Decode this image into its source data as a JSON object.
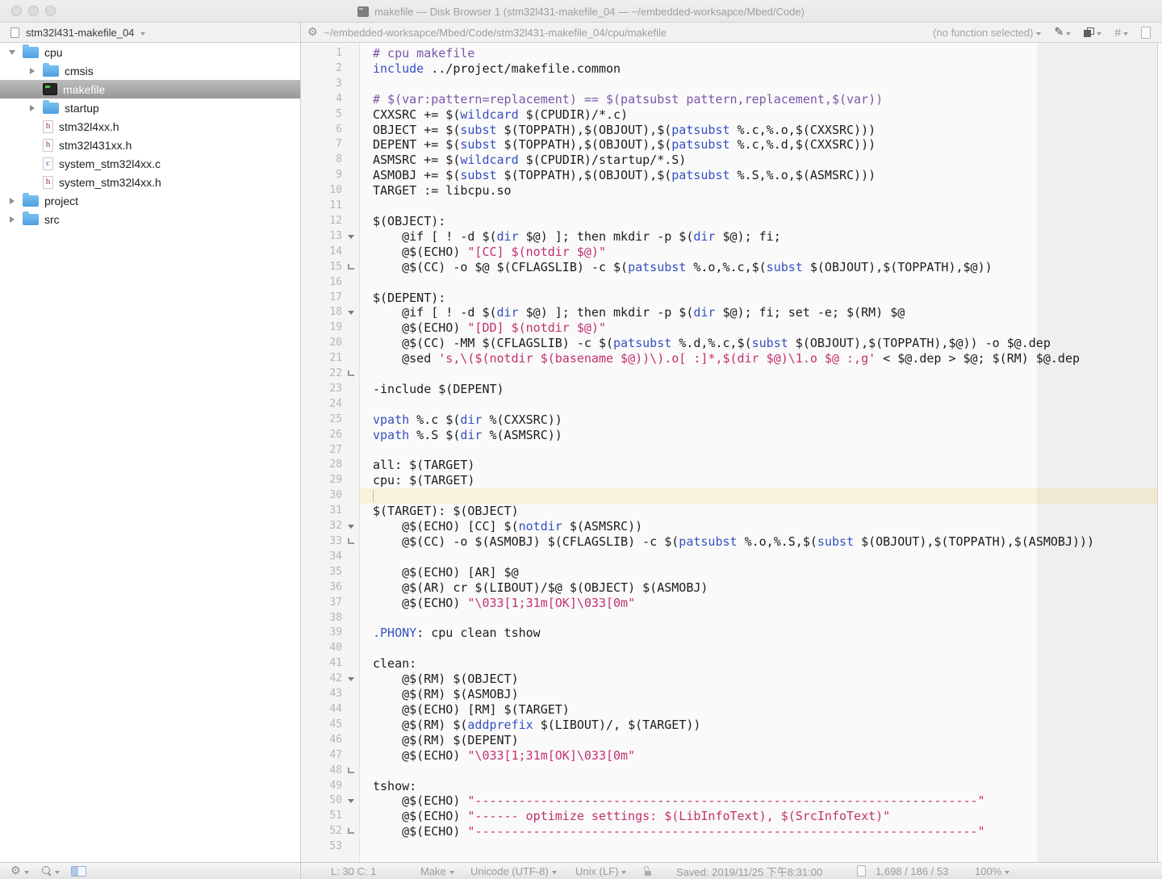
{
  "window": {
    "title": "makefile — Disk Browser 1 (stm32l431-makefile_04 — ~/embedded-worksapce/Mbed/Code)"
  },
  "project_bar": {
    "name": "stm32l431-makefile_04"
  },
  "path_bar": {
    "path": "~/embedded-worksapce/Mbed/Code/stm32l431-makefile_04/cpu/makefile",
    "function_selector": "(no function selected)"
  },
  "icons": {
    "gear": "⚙",
    "pencil": "✎",
    "traffic_lights": "inactive-gray",
    "search": "magnifier-shape",
    "panel_toggle": "split-rect",
    "lock": "unlocked-padlock"
  },
  "colors": {
    "keyword": "#3550c2",
    "comment": "#7a56a8",
    "string": "#c3306f",
    "plain": "#1c1c1c",
    "current_line": "#f8f4da",
    "selection_gray_top": "#bcbcbc",
    "folder_blue": "#4d9fe0"
  },
  "sidebar": {
    "items": [
      {
        "label": "cpu",
        "depth": 0,
        "icon": "folder",
        "disclosure": "open",
        "selected": false
      },
      {
        "label": "cmsis",
        "depth": 1,
        "icon": "folder",
        "disclosure": "closed",
        "selected": false
      },
      {
        "label": "makefile",
        "depth": 1,
        "icon": "makefile",
        "disclosure": "none",
        "selected": true
      },
      {
        "label": "startup",
        "depth": 1,
        "icon": "folder",
        "disclosure": "closed",
        "selected": false
      },
      {
        "label": "stm32l4xx.h",
        "depth": 1,
        "icon": "h",
        "disclosure": "none",
        "selected": false
      },
      {
        "label": "stm32l431xx.h",
        "depth": 1,
        "icon": "h",
        "disclosure": "none",
        "selected": false
      },
      {
        "label": "system_stm32l4xx.c",
        "depth": 1,
        "icon": "c",
        "disclosure": "none",
        "selected": false
      },
      {
        "label": "system_stm32l4xx.h",
        "depth": 1,
        "icon": "h",
        "disclosure": "none",
        "selected": false
      },
      {
        "label": "project",
        "depth": 0,
        "icon": "folder",
        "disclosure": "closed",
        "selected": false
      },
      {
        "label": "src",
        "depth": 0,
        "icon": "folder",
        "disclosure": "closed",
        "selected": false
      }
    ]
  },
  "editor": {
    "caret_line": 30,
    "lines": [
      {
        "n": 1,
        "fold": "",
        "cur": false,
        "spans": [
          [
            "c",
            "# cpu makefile"
          ]
        ]
      },
      {
        "n": 2,
        "fold": "",
        "cur": false,
        "spans": [
          [
            "k",
            "include"
          ],
          [
            "t",
            " ../project/makefile.common"
          ]
        ]
      },
      {
        "n": 3,
        "fold": "",
        "cur": false,
        "spans": []
      },
      {
        "n": 4,
        "fold": "",
        "cur": false,
        "spans": [
          [
            "c",
            "# $(var:pattern=replacement) == $(patsubst pattern,replacement,$(var))"
          ]
        ]
      },
      {
        "n": 5,
        "fold": "",
        "cur": false,
        "spans": [
          [
            "t",
            "CXXSRC += $("
          ],
          [
            "k",
            "wildcard"
          ],
          [
            "t",
            " $(CPUDIR)/*.c)"
          ]
        ]
      },
      {
        "n": 6,
        "fold": "",
        "cur": false,
        "spans": [
          [
            "t",
            "OBJECT += $("
          ],
          [
            "k",
            "subst"
          ],
          [
            "t",
            " $(TOPPATH),$(OBJOUT),$("
          ],
          [
            "k",
            "patsubst"
          ],
          [
            "t",
            " %.c,%.o,$(CXXSRC)))"
          ]
        ]
      },
      {
        "n": 7,
        "fold": "",
        "cur": false,
        "spans": [
          [
            "t",
            "DEPENT += $("
          ],
          [
            "k",
            "subst"
          ],
          [
            "t",
            " $(TOPPATH),$(OBJOUT),$("
          ],
          [
            "k",
            "patsubst"
          ],
          [
            "t",
            " %.c,%.d,$(CXXSRC)))"
          ]
        ]
      },
      {
        "n": 8,
        "fold": "",
        "cur": false,
        "spans": [
          [
            "t",
            "ASMSRC += $("
          ],
          [
            "k",
            "wildcard"
          ],
          [
            "t",
            " $(CPUDIR)/startup/*.S)"
          ]
        ]
      },
      {
        "n": 9,
        "fold": "",
        "cur": false,
        "spans": [
          [
            "t",
            "ASMOBJ += $("
          ],
          [
            "k",
            "subst"
          ],
          [
            "t",
            " $(TOPPATH),$(OBJOUT),$("
          ],
          [
            "k",
            "patsubst"
          ],
          [
            "t",
            " %.S,%.o,$(ASMSRC)))"
          ]
        ]
      },
      {
        "n": 10,
        "fold": "",
        "cur": false,
        "spans": [
          [
            "t",
            "TARGET := libcpu.so"
          ]
        ]
      },
      {
        "n": 11,
        "fold": "",
        "cur": false,
        "spans": []
      },
      {
        "n": 12,
        "fold": "",
        "cur": false,
        "spans": [
          [
            "t",
            "$(OBJECT):"
          ]
        ]
      },
      {
        "n": 13,
        "fold": "start",
        "cur": false,
        "spans": [
          [
            "t",
            "    @if [ ! -d $("
          ],
          [
            "k",
            "dir"
          ],
          [
            "t",
            " $@) ]; then mkdir -p $("
          ],
          [
            "k",
            "dir"
          ],
          [
            "t",
            " $@); fi;"
          ]
        ]
      },
      {
        "n": 14,
        "fold": "",
        "cur": false,
        "spans": [
          [
            "t",
            "    @$(ECHO) "
          ],
          [
            "s",
            "\"[CC] $(notdir $@)\""
          ]
        ]
      },
      {
        "n": 15,
        "fold": "end",
        "cur": false,
        "spans": [
          [
            "t",
            "    @$(CC) -o $@ $(CFLAGSLIB) -c $("
          ],
          [
            "k",
            "patsubst"
          ],
          [
            "t",
            " %.o,%.c,$("
          ],
          [
            "k",
            "subst"
          ],
          [
            "t",
            " $(OBJOUT),$(TOPPATH),$@))"
          ]
        ]
      },
      {
        "n": 16,
        "fold": "",
        "cur": false,
        "spans": []
      },
      {
        "n": 17,
        "fold": "",
        "cur": false,
        "spans": [
          [
            "t",
            "$(DEPENT):"
          ]
        ]
      },
      {
        "n": 18,
        "fold": "start",
        "cur": false,
        "spans": [
          [
            "t",
            "    @if [ ! -d $("
          ],
          [
            "k",
            "dir"
          ],
          [
            "t",
            " $@) ]; then mkdir -p $("
          ],
          [
            "k",
            "dir"
          ],
          [
            "t",
            " $@); fi; set -e; $(RM) $@"
          ]
        ]
      },
      {
        "n": 19,
        "fold": "",
        "cur": false,
        "spans": [
          [
            "t",
            "    @$(ECHO) "
          ],
          [
            "s",
            "\"[DD] $(notdir $@)\""
          ]
        ]
      },
      {
        "n": 20,
        "fold": "",
        "cur": false,
        "spans": [
          [
            "t",
            "    @$(CC) -MM $(CFLAGSLIB) -c $("
          ],
          [
            "k",
            "patsubst"
          ],
          [
            "t",
            " %.d,%.c,$("
          ],
          [
            "k",
            "subst"
          ],
          [
            "t",
            " $(OBJOUT),$(TOPPATH),$@)) -o $@.dep"
          ]
        ]
      },
      {
        "n": 21,
        "fold": "",
        "cur": false,
        "spans": [
          [
            "t",
            "    @sed "
          ],
          [
            "s",
            "'s,\\($(notdir $(basename $@))\\).o[ :]*,$(dir $@)\\1.o $@ :,g'"
          ],
          [
            "t",
            " < $@.dep > $@; $(RM) $@.dep"
          ]
        ]
      },
      {
        "n": 22,
        "fold": "end",
        "cur": false,
        "spans": []
      },
      {
        "n": 23,
        "fold": "",
        "cur": false,
        "spans": [
          [
            "t",
            "-include $(DEPENT)"
          ]
        ]
      },
      {
        "n": 24,
        "fold": "",
        "cur": false,
        "spans": []
      },
      {
        "n": 25,
        "fold": "",
        "cur": false,
        "spans": [
          [
            "k",
            "vpath"
          ],
          [
            "t",
            " %.c $("
          ],
          [
            "k",
            "dir"
          ],
          [
            "t",
            " %(CXXSRC))"
          ]
        ]
      },
      {
        "n": 26,
        "fold": "",
        "cur": false,
        "spans": [
          [
            "k",
            "vpath"
          ],
          [
            "t",
            " %.S $("
          ],
          [
            "k",
            "dir"
          ],
          [
            "t",
            " %(ASMSRC))"
          ]
        ]
      },
      {
        "n": 27,
        "fold": "",
        "cur": false,
        "spans": []
      },
      {
        "n": 28,
        "fold": "",
        "cur": false,
        "spans": [
          [
            "t",
            "all: $(TARGET)"
          ]
        ]
      },
      {
        "n": 29,
        "fold": "",
        "cur": false,
        "spans": [
          [
            "t",
            "cpu: $(TARGET)"
          ]
        ]
      },
      {
        "n": 30,
        "fold": "",
        "cur": true,
        "spans": []
      },
      {
        "n": 31,
        "fold": "",
        "cur": false,
        "spans": [
          [
            "t",
            "$(TARGET): $(OBJECT)"
          ]
        ]
      },
      {
        "n": 32,
        "fold": "start",
        "cur": false,
        "spans": [
          [
            "t",
            "    @$(ECHO) [CC] $("
          ],
          [
            "k",
            "notdir"
          ],
          [
            "t",
            " $(ASMSRC))"
          ]
        ]
      },
      {
        "n": 33,
        "fold": "end",
        "cur": false,
        "spans": [
          [
            "t",
            "    @$(CC) -o $(ASMOBJ) $(CFLAGSLIB) -c $("
          ],
          [
            "k",
            "patsubst"
          ],
          [
            "t",
            " %.o,%.S,$("
          ],
          [
            "k",
            "subst"
          ],
          [
            "t",
            " $(OBJOUT),$(TOPPATH),$(ASMOBJ)))"
          ]
        ]
      },
      {
        "n": 34,
        "fold": "",
        "cur": false,
        "spans": []
      },
      {
        "n": 35,
        "fold": "",
        "cur": false,
        "spans": [
          [
            "t",
            "    @$(ECHO) [AR] $@"
          ]
        ]
      },
      {
        "n": 36,
        "fold": "",
        "cur": false,
        "spans": [
          [
            "t",
            "    @$(AR) cr $(LIBOUT)/$@ $(OBJECT) $(ASMOBJ)"
          ]
        ]
      },
      {
        "n": 37,
        "fold": "",
        "cur": false,
        "spans": [
          [
            "t",
            "    @$(ECHO) "
          ],
          [
            "s",
            "\"\\033[1;31m[OK]\\033[0m\""
          ]
        ]
      },
      {
        "n": 38,
        "fold": "",
        "cur": false,
        "spans": []
      },
      {
        "n": 39,
        "fold": "",
        "cur": false,
        "spans": [
          [
            "k",
            ".PHONY"
          ],
          [
            "t",
            ": cpu clean tshow"
          ]
        ]
      },
      {
        "n": 40,
        "fold": "",
        "cur": false,
        "spans": []
      },
      {
        "n": 41,
        "fold": "",
        "cur": false,
        "spans": [
          [
            "t",
            "clean:"
          ]
        ]
      },
      {
        "n": 42,
        "fold": "start",
        "cur": false,
        "spans": [
          [
            "t",
            "    @$(RM) $(OBJECT)"
          ]
        ]
      },
      {
        "n": 43,
        "fold": "",
        "cur": false,
        "spans": [
          [
            "t",
            "    @$(RM) $(ASMOBJ)"
          ]
        ]
      },
      {
        "n": 44,
        "fold": "",
        "cur": false,
        "spans": [
          [
            "t",
            "    @$(ECHO) [RM] $(TARGET)"
          ]
        ]
      },
      {
        "n": 45,
        "fold": "",
        "cur": false,
        "spans": [
          [
            "t",
            "    @$(RM) $("
          ],
          [
            "k",
            "addprefix"
          ],
          [
            "t",
            " $(LIBOUT)/, $(TARGET))"
          ]
        ]
      },
      {
        "n": 46,
        "fold": "",
        "cur": false,
        "spans": [
          [
            "t",
            "    @$(RM) $(DEPENT)"
          ]
        ]
      },
      {
        "n": 47,
        "fold": "",
        "cur": false,
        "spans": [
          [
            "t",
            "    @$(ECHO) "
          ],
          [
            "s",
            "\"\\033[1;31m[OK]\\033[0m\""
          ]
        ]
      },
      {
        "n": 48,
        "fold": "end",
        "cur": false,
        "spans": []
      },
      {
        "n": 49,
        "fold": "",
        "cur": false,
        "spans": [
          [
            "t",
            "tshow:"
          ]
        ]
      },
      {
        "n": 50,
        "fold": "start",
        "cur": false,
        "spans": [
          [
            "t",
            "    @$(ECHO) "
          ],
          [
            "s",
            "\"---------------------------------------------------------------------\""
          ]
        ]
      },
      {
        "n": 51,
        "fold": "",
        "cur": false,
        "spans": [
          [
            "t",
            "    @$(ECHO) "
          ],
          [
            "s",
            "\"------ optimize settings: $(LibInfoText), $(SrcInfoText)\""
          ]
        ]
      },
      {
        "n": 52,
        "fold": "end",
        "cur": false,
        "spans": [
          [
            "t",
            "    @$(ECHO) "
          ],
          [
            "s",
            "\"---------------------------------------------------------------------\""
          ]
        ]
      },
      {
        "n": 53,
        "fold": "",
        "cur": false,
        "spans": []
      }
    ]
  },
  "status_bar": {
    "position": "L: 30 C: 1",
    "language": "Make",
    "encoding": "Unicode (UTF-8)",
    "line_ending": "Unix (LF)",
    "saved": "Saved: 2019/11/25 下午8:31:00",
    "counts": "1,698 / 186 / 53",
    "zoom": "100%"
  }
}
